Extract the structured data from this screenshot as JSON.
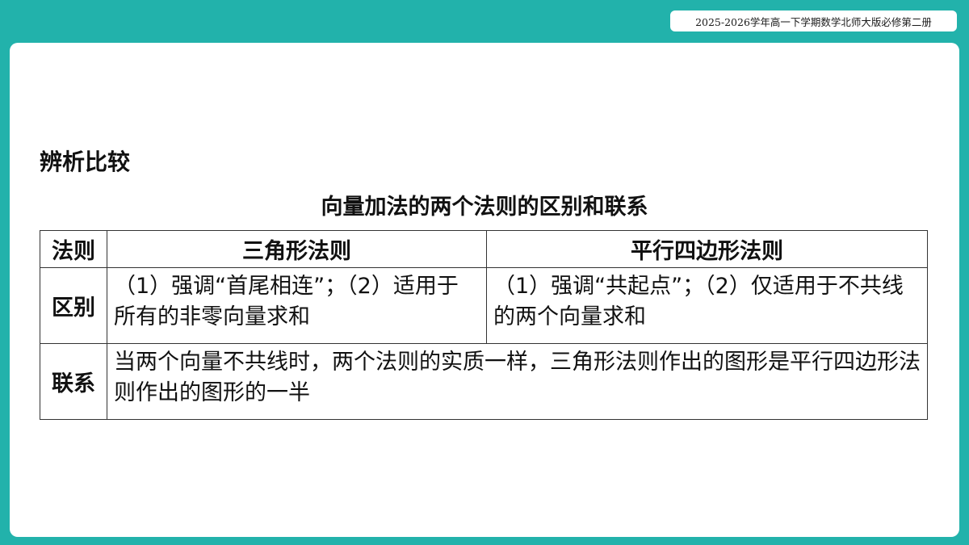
{
  "header": {
    "course_label": "2025-2026学年高一下学期数学北师大版必修第二册"
  },
  "content": {
    "section_heading": "辨析比较",
    "table_title": "向量加法的两个法则的区别和联系",
    "table": {
      "headers": [
        "法则",
        "三角形法则",
        "平行四边形法则"
      ],
      "rows": [
        {
          "label": "区别",
          "cells": [
            "（1）强调“首尾相连”；（2）适用于所有的非零向量求和",
            "（1）强调“共起点”；（2）仅适用于不共线的两个向量求和"
          ]
        },
        {
          "label": "联系",
          "cells": [
            "当两个向量不共线时，两个法则的实质一样，三角形法则作出的图形是平行四边形法则作出的图形的一半"
          ]
        }
      ]
    }
  },
  "colors": {
    "frame": "#22b2ab",
    "card": "#ffffff",
    "text": "#111111"
  }
}
